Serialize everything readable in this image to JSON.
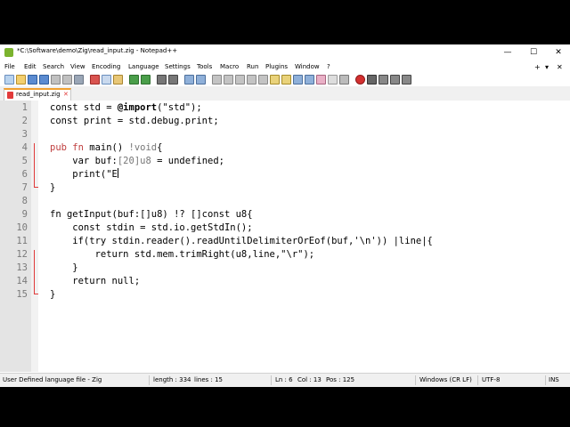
{
  "window": {
    "title": "*C:\\Software\\demo\\Zig\\read_input.zig - Notepad++",
    "controls": [
      "—",
      "☐",
      "✕"
    ]
  },
  "menubar": {
    "items": [
      "File",
      "Edit",
      "Search",
      "View",
      "Encoding",
      "Language",
      "Settings",
      "Tools",
      "Macro",
      "Run",
      "Plugins",
      "Window",
      "?"
    ],
    "right": [
      "+",
      "▾",
      "✕"
    ]
  },
  "tabs": [
    {
      "label": "read_input.zig",
      "close": "✕"
    }
  ],
  "editor": {
    "lines": [
      1,
      2,
      3,
      4,
      5,
      6,
      7,
      8,
      9,
      10,
      11,
      12,
      13,
      14,
      15
    ]
  },
  "statusbar": {
    "filetype": "User Defined language file - Zig",
    "length": "length : 334",
    "lines": "lines : 15",
    "ln": "Ln : 6",
    "col": "Col : 13",
    "pos": "Pos : 125",
    "eol": "Windows (CR LF)",
    "encoding": "UTF-8",
    "mode": "INS"
  },
  "colors": {
    "keyword": "#c04040",
    "fold_marker": "#e03a3a",
    "tab_accent": "#f0a030"
  }
}
